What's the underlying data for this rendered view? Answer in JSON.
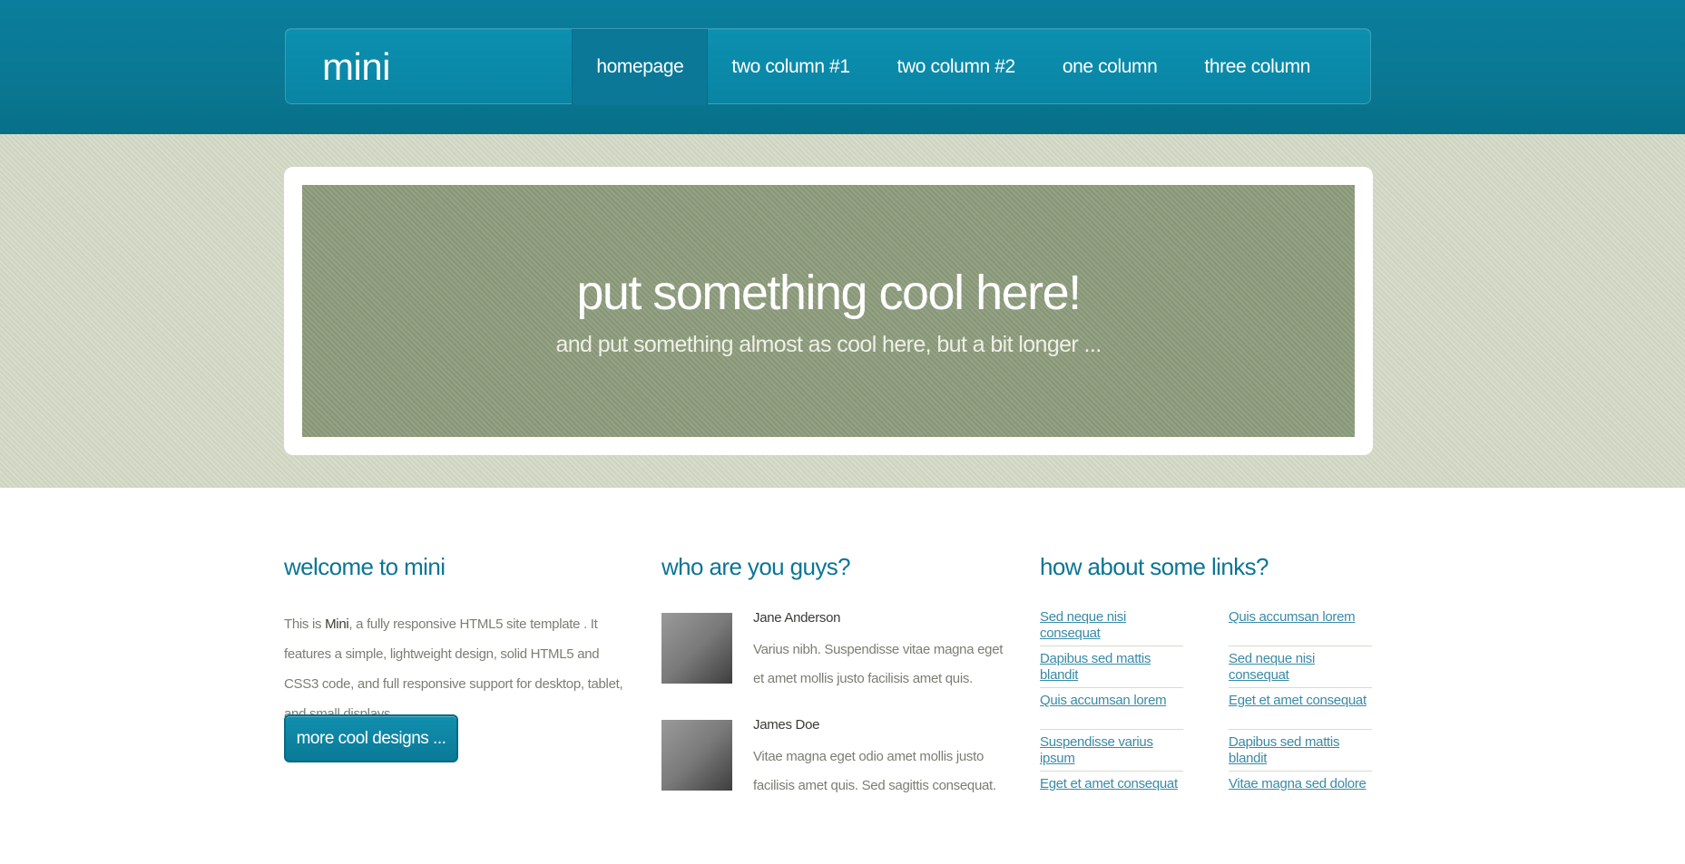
{
  "header": {
    "logo": "mini",
    "nav": [
      {
        "label": "homepage",
        "active": true
      },
      {
        "label": "two column #1"
      },
      {
        "label": "two column #2"
      },
      {
        "label": "one column"
      },
      {
        "label": "three column"
      }
    ]
  },
  "hero": {
    "title": "put something cool here!",
    "subtitle": "and put something almost as cool here, but a bit longer ..."
  },
  "welcome": {
    "title": "welcome to mini",
    "text_before": "This is ",
    "brand": "Mini",
    "text_after": ", a fully responsive HTML5 site template . It features a simple, lightweight design, solid HTML5 and CSS3 code, and full responsive support for desktop, tablet, and small displays.",
    "button": "more cool designs ..."
  },
  "people": {
    "title": "who are you guys?",
    "items": [
      {
        "name": "Jane Anderson",
        "text": "Varius nibh. Suspendisse vitae magna eget et amet mollis justo facilisis amet quis."
      },
      {
        "name": "James Doe",
        "text": "Vitae magna eget odio amet mollis justo facilisis amet quis. Sed sagittis consequat."
      }
    ]
  },
  "links": {
    "title": "how about some links?",
    "left": [
      "Sed neque nisi consequat",
      "Dapibus sed mattis blandit",
      "Quis accumsan lorem",
      "Suspendisse varius ipsum",
      "Eget et amet consequat"
    ],
    "right": [
      "Quis accumsan lorem",
      "Sed neque nisi consequat",
      "Eget et amet consequat",
      "Dapibus sed mattis blandit",
      "Vitae magna sed dolore"
    ]
  },
  "colors": {
    "header": "#0a7e9c",
    "accent": "#0b7596",
    "hero_bg": "#d2d8c4",
    "hero_panel": "#8e9c7d"
  }
}
